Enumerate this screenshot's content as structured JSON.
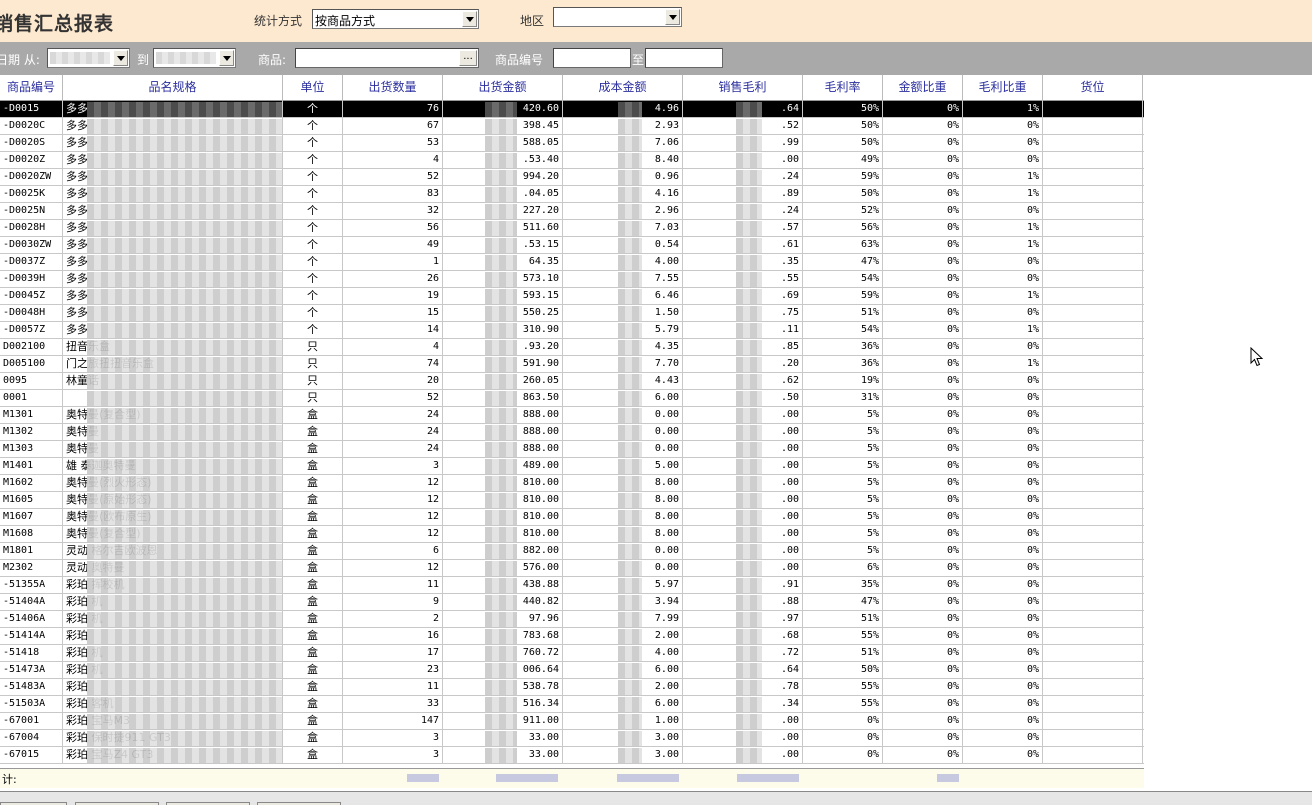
{
  "header": {
    "title": "销售汇总报表",
    "stat_method_label": "统计方式",
    "stat_method_value": "按商品方式",
    "region_label": "地区",
    "region_value": ""
  },
  "filters": {
    "date_label": "日期 从:",
    "to_label": "到",
    "product_label": "商品:",
    "product_button": "...",
    "code_label": "商品编号",
    "code_to_label": "至"
  },
  "columns": [
    "商品编号",
    "品名规格",
    "单位",
    "出货数量",
    "出货金额",
    "成本金额",
    "销售毛利",
    "毛利率",
    "金额比重",
    "毛利比重",
    "货位"
  ],
  "rows": [
    {
      "code": "-D0015",
      "name": "多多",
      "unit": "个",
      "qty": "76",
      "amt": "420.60",
      "cost": "4.96",
      "profit": ".64",
      "rate": "50%",
      "amtw": "0%",
      "profw": "1%"
    },
    {
      "code": "-D0020C",
      "name": "多多",
      "unit": "个",
      "qty": "67",
      "amt": "398.45",
      "cost": "2.93",
      "profit": ".52",
      "rate": "50%",
      "amtw": "0%",
      "profw": "0%"
    },
    {
      "code": "-D0020S",
      "name": "多多",
      "unit": "个",
      "qty": "53",
      "amt": "588.05",
      "cost": "7.06",
      "profit": ".99",
      "rate": "50%",
      "amtw": "0%",
      "profw": "0%"
    },
    {
      "code": "-D0020Z",
      "name": "多多",
      "unit": "个",
      "qty": "4",
      "amt": ".53.40",
      "cost": "8.40",
      "profit": ".00",
      "rate": "49%",
      "amtw": "0%",
      "profw": "0%"
    },
    {
      "code": "-D0020ZW",
      "name": "多多",
      "unit": "个",
      "qty": "52",
      "amt": "994.20",
      "cost": "0.96",
      "profit": ".24",
      "rate": "59%",
      "amtw": "0%",
      "profw": "1%"
    },
    {
      "code": "-D0025K",
      "name": "多多",
      "unit": "个",
      "qty": "83",
      "amt": ".04.05",
      "cost": "4.16",
      "profit": ".89",
      "rate": "50%",
      "amtw": "0%",
      "profw": "1%"
    },
    {
      "code": "-D0025N",
      "name": "多多",
      "unit": "个",
      "qty": "32",
      "amt": "227.20",
      "cost": "2.96",
      "profit": ".24",
      "rate": "52%",
      "amtw": "0%",
      "profw": "0%"
    },
    {
      "code": "-D0028H",
      "name": "多多",
      "unit": "个",
      "qty": "56",
      "amt": "511.60",
      "cost": "7.03",
      "profit": ".57",
      "rate": "56%",
      "amtw": "0%",
      "profw": "1%"
    },
    {
      "code": "-D0030ZW",
      "name": "多多",
      "unit": "个",
      "qty": "49",
      "amt": ".53.15",
      "cost": "0.54",
      "profit": ".61",
      "rate": "63%",
      "amtw": "0%",
      "profw": "1%"
    },
    {
      "code": "-D0037Z",
      "name": "多多",
      "unit": "个",
      "qty": "1",
      "amt": "64.35",
      "cost": "4.00",
      "profit": ".35",
      "rate": "47%",
      "amtw": "0%",
      "profw": "0%"
    },
    {
      "code": "-D0039H",
      "name": "多多",
      "unit": "个",
      "qty": "26",
      "amt": "573.10",
      "cost": "7.55",
      "profit": ".55",
      "rate": "54%",
      "amtw": "0%",
      "profw": "0%"
    },
    {
      "code": "-D0045Z",
      "name": "多多",
      "unit": "个",
      "qty": "19",
      "amt": "593.15",
      "cost": "6.46",
      "profit": ".69",
      "rate": "59%",
      "amtw": "0%",
      "profw": "1%"
    },
    {
      "code": "-D0048H",
      "name": "多多",
      "unit": "个",
      "qty": "15",
      "amt": "550.25",
      "cost": "1.50",
      "profit": ".75",
      "rate": "51%",
      "amtw": "0%",
      "profw": "0%"
    },
    {
      "code": "-D0057Z",
      "name": "多多",
      "unit": "个",
      "qty": "14",
      "amt": "310.90",
      "cost": "5.79",
      "profit": ".11",
      "rate": "54%",
      "amtw": "0%",
      "profw": "1%"
    },
    {
      "code": "D002100",
      "name": "扭音乐盒",
      "unit": "只",
      "qty": "4",
      "amt": ".93.20",
      "cost": "4.35",
      "profit": ".85",
      "rate": "36%",
      "amtw": "0%",
      "profw": "0%"
    },
    {
      "code": "D005100",
      "name": "门之旅扭扭音乐盒",
      "unit": "只",
      "qty": "74",
      "amt": "591.90",
      "cost": "7.70",
      "profit": ".20",
      "rate": "36%",
      "amtw": "0%",
      "profw": "1%"
    },
    {
      "code": "0095",
      "name": "林童话",
      "unit": "只",
      "qty": "20",
      "amt": "260.05",
      "cost": "4.43",
      "profit": ".62",
      "rate": "19%",
      "amtw": "0%",
      "profw": "0%"
    },
    {
      "code": "0001",
      "name": "",
      "unit": "只",
      "qty": "52",
      "amt": "863.50",
      "cost": "6.00",
      "profit": ".50",
      "rate": "31%",
      "amtw": "0%",
      "profw": "0%"
    },
    {
      "code": "M1301",
      "name": "奥特曼(复合型)",
      "unit": "盒",
      "qty": "24",
      "amt": "888.00",
      "cost": "0.00",
      "profit": ".00",
      "rate": "5%",
      "amtw": "0%",
      "profw": "0%"
    },
    {
      "code": "M1302",
      "name": "奥特曼",
      "unit": "盒",
      "qty": "24",
      "amt": "888.00",
      "cost": "0.00",
      "profit": ".00",
      "rate": "5%",
      "amtw": "0%",
      "profw": "0%"
    },
    {
      "code": "M1303",
      "name": "奥特曼",
      "unit": "盒",
      "qty": "24",
      "amt": "888.00",
      "cost": "0.00",
      "profit": ".00",
      "rate": "5%",
      "amtw": "0%",
      "profw": "0%"
    },
    {
      "code": "M1401",
      "name": "雄 泰迦奥特曼",
      "unit": "盒",
      "qty": "3",
      "amt": "489.00",
      "cost": "5.00",
      "profit": ".00",
      "rate": "5%",
      "amtw": "0%",
      "profw": "0%"
    },
    {
      "code": "M1602",
      "name": "奥特曼(烈火形态)",
      "unit": "盒",
      "qty": "12",
      "amt": "810.00",
      "cost": "8.00",
      "profit": ".00",
      "rate": "5%",
      "amtw": "0%",
      "profw": "0%"
    },
    {
      "code": "M1605",
      "name": "奥特曼(原始形态)",
      "unit": "盒",
      "qty": "12",
      "amt": "810.00",
      "cost": "8.00",
      "profit": ".00",
      "rate": "5%",
      "amtw": "0%",
      "profw": "0%"
    },
    {
      "code": "M1607",
      "name": "奥特曼(欧布原生)",
      "unit": "盒",
      "qty": "12",
      "amt": "810.00",
      "cost": "8.00",
      "profit": ".00",
      "rate": "5%",
      "amtw": "0%",
      "profw": "0%"
    },
    {
      "code": "M1608",
      "name": "奥特曼(复合型)",
      "unit": "盒",
      "qty": "12",
      "amt": "810.00",
      "cost": "8.00",
      "profit": ".00",
      "rate": "5%",
      "amtw": "0%",
      "profw": "0%"
    },
    {
      "code": "M1801",
      "name": "灵动 格尔吉欧波恩",
      "unit": "盒",
      "qty": "6",
      "amt": "882.00",
      "cost": "0.00",
      "profit": ".00",
      "rate": "5%",
      "amtw": "0%",
      "profw": "0%"
    },
    {
      "code": "M2302",
      "name": "灵动 奥特曼",
      "unit": "盒",
      "qty": "12",
      "amt": "576.00",
      "cost": "0.00",
      "profit": ".00",
      "rate": "6%",
      "amtw": "0%",
      "profw": "0%"
    },
    {
      "code": "-51355A",
      "name": "彩珀 挥校机",
      "unit": "盒",
      "qty": "11",
      "amt": "438.88",
      "cost": "5.97",
      "profit": ".91",
      "rate": "35%",
      "amtw": "0%",
      "profw": "0%"
    },
    {
      "code": "-51404A",
      "name": "彩珀 机",
      "unit": "盒",
      "qty": "9",
      "amt": "440.82",
      "cost": "3.94",
      "profit": ".88",
      "rate": "47%",
      "amtw": "0%",
      "profw": "0%"
    },
    {
      "code": "-51406A",
      "name": "彩珀 机",
      "unit": "盒",
      "qty": "2",
      "amt": "97.96",
      "cost": "7.99",
      "profit": ".97",
      "rate": "51%",
      "amtw": "0%",
      "profw": "0%"
    },
    {
      "code": "-51414A",
      "name": "彩珀",
      "unit": "盒",
      "qty": "16",
      "amt": "783.68",
      "cost": "2.00",
      "profit": ".68",
      "rate": "55%",
      "amtw": "0%",
      "profw": "0%"
    },
    {
      "code": "-51418",
      "name": "彩珀 机",
      "unit": "盒",
      "qty": "17",
      "amt": "760.72",
      "cost": "4.00",
      "profit": ".72",
      "rate": "51%",
      "amtw": "0%",
      "profw": "0%"
    },
    {
      "code": "-51473A",
      "name": "彩珀 机",
      "unit": "盒",
      "qty": "23",
      "amt": "006.64",
      "cost": "6.00",
      "profit": ".64",
      "rate": "50%",
      "amtw": "0%",
      "profw": "0%"
    },
    {
      "code": "-51483A",
      "name": "彩珀",
      "unit": "盒",
      "qty": "11",
      "amt": "538.78",
      "cost": "2.00",
      "profit": ".78",
      "rate": "55%",
      "amtw": "0%",
      "profw": "0%"
    },
    {
      "code": "-51503A",
      "name": "彩珀 客机",
      "unit": "盒",
      "qty": "33",
      "amt": "516.34",
      "cost": "6.00",
      "profit": ".34",
      "rate": "55%",
      "amtw": "0%",
      "profw": "0%"
    },
    {
      "code": "-67001",
      "name": "彩珀 宝马M3",
      "unit": "盒",
      "qty": "147",
      "amt": "911.00",
      "cost": "1.00",
      "profit": ".00",
      "rate": "0%",
      "amtw": "0%",
      "profw": "0%"
    },
    {
      "code": "-67004",
      "name": "彩珀 保时捷911 GT3",
      "unit": "盒",
      "qty": "3",
      "amt": "33.00",
      "cost": "3.00",
      "profit": ".00",
      "rate": "0%",
      "amtw": "0%",
      "profw": "0%"
    },
    {
      "code": "-67015",
      "name": "彩珀 宝马Z4 GT3",
      "unit": "盒",
      "qty": "3",
      "amt": "33.00",
      "cost": "3.00",
      "profit": ".00",
      "rate": "0%",
      "amtw": "0%",
      "profw": "0%"
    }
  ],
  "total": {
    "label": "计:"
  }
}
